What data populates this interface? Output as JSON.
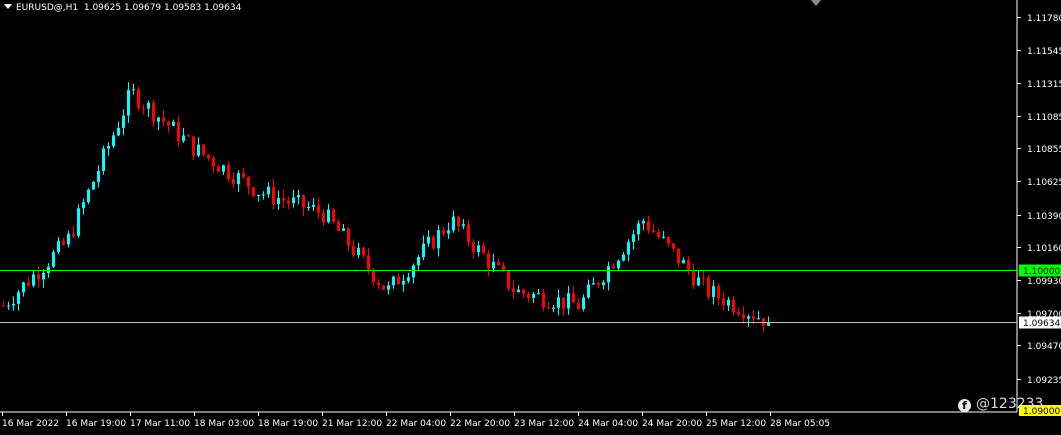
{
  "header": {
    "symbol": "EURUSD@,H1",
    "ohlc": "1.09625 1.09679 1.09583 1.09634"
  },
  "watermark": {
    "icon": "facebook-icon",
    "text": "@123233"
  },
  "colors": {
    "background": "#000000",
    "bull": "#00ffff",
    "bear": "#ff0000",
    "axis": "#ffffff",
    "level_line": "#00ff00",
    "price_line": "#c0c0c0"
  },
  "chart_data": {
    "type": "candlestick",
    "timeframe": "H1",
    "ylim": [
      1.09,
      1.119
    ],
    "y_ticks": [
      "1.11780",
      "1.11545",
      "1.11315",
      "1.11085",
      "1.10855",
      "1.10625",
      "1.10390",
      "1.10160",
      "1.09930",
      "1.09700",
      "1.09470",
      "1.09235"
    ],
    "x_ticks": [
      "16 Mar 2022",
      "16 Mar 19:00",
      "17 Mar 11:00",
      "18 Mar 03:00",
      "18 Mar 19:00",
      "21 Mar 12:00",
      "22 Mar 04:00",
      "22 Mar 20:00",
      "23 Mar 12:00",
      "24 Mar 04:00",
      "24 Mar 20:00",
      "25 Mar 12:00",
      "28 Mar 05:05"
    ],
    "horizontal_lines": [
      {
        "price": 1.1,
        "label": "1.10000",
        "role": "level"
      },
      {
        "price": 1.09634,
        "label": "1.09634",
        "role": "current"
      }
    ],
    "bottom_label": "1.09000",
    "anchors": [
      [
        "16 Mar 2022",
        1.0975
      ],
      [
        "16 Mar 19:00",
        1.102
      ],
      [
        "17 Mar 11:00",
        1.1125
      ],
      [
        "18 Mar 03:00",
        1.1085
      ],
      [
        "18 Mar 19:00",
        1.1055
      ],
      [
        "21 Mar 12:00",
        1.104
      ],
      [
        "22 Mar 04:00",
        1.0985
      ],
      [
        "22 Mar 20:00",
        1.1035
      ],
      [
        "23 Mar 12:00",
        1.0985
      ],
      [
        "24 Mar 04:00",
        1.0975
      ],
      [
        "24 Mar 20:00",
        1.1035
      ],
      [
        "25 Mar 12:00",
        1.0985
      ],
      [
        "28 Mar 05:05",
        1.0963
      ]
    ]
  }
}
